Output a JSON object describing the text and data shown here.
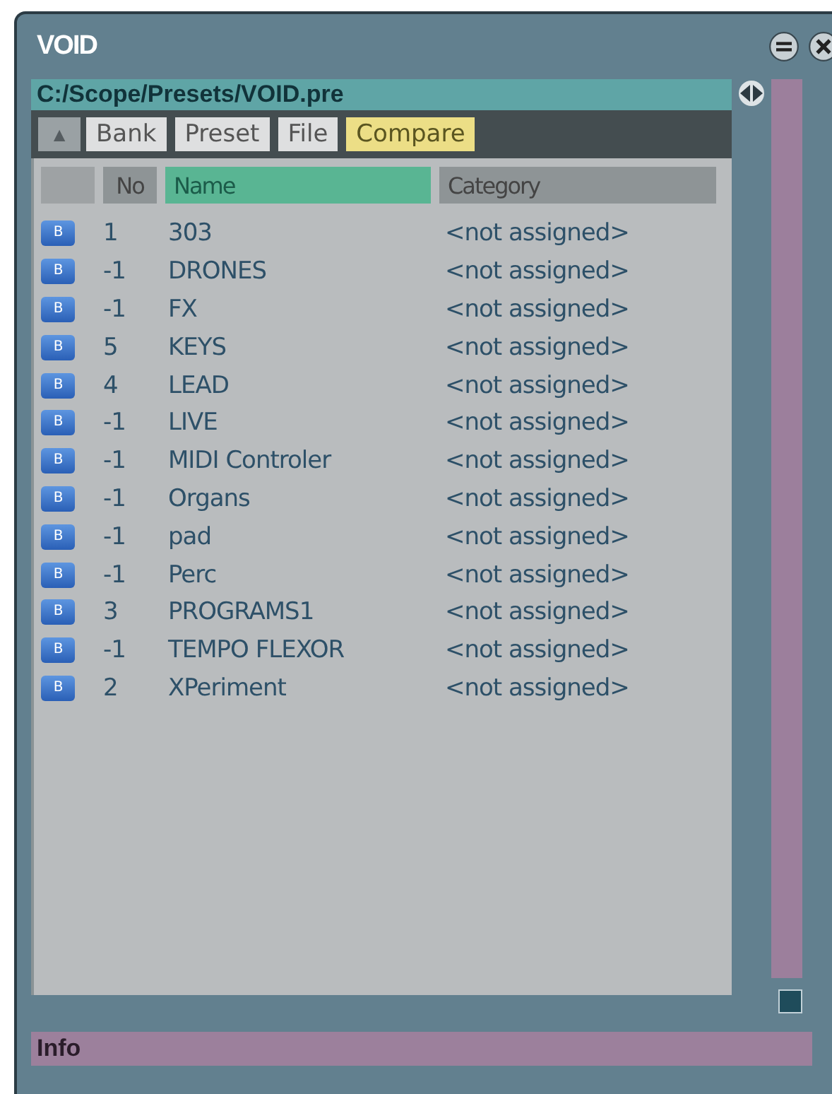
{
  "window": {
    "title": "VOID"
  },
  "path": "C:/Scope/Presets/VOID.pre",
  "toolbar": {
    "up_button": "▲",
    "tabs": [
      {
        "label": "Bank",
        "selected": false
      },
      {
        "label": "Preset",
        "selected": false
      },
      {
        "label": "File",
        "selected": false
      },
      {
        "label": "Compare",
        "selected": true
      }
    ]
  },
  "table": {
    "columns": [
      {
        "label": "No",
        "selected": false
      },
      {
        "label": "Name",
        "selected": true
      },
      {
        "label": "Category",
        "selected": false
      }
    ],
    "rows": [
      {
        "icon_letter": "B",
        "no": "1",
        "name": "303",
        "category": "<not assigned>"
      },
      {
        "icon_letter": "B",
        "no": "-1",
        "name": "DRONES",
        "category": "<not assigned>"
      },
      {
        "icon_letter": "B",
        "no": "-1",
        "name": "FX",
        "category": "<not assigned>"
      },
      {
        "icon_letter": "B",
        "no": "5",
        "name": "KEYS",
        "category": "<not assigned>"
      },
      {
        "icon_letter": "B",
        "no": "4",
        "name": "LEAD",
        "category": "<not assigned>"
      },
      {
        "icon_letter": "B",
        "no": "-1",
        "name": "LIVE",
        "category": "<not assigned>"
      },
      {
        "icon_letter": "B",
        "no": "-1",
        "name": "MIDI Controler",
        "category": "<not assigned>"
      },
      {
        "icon_letter": "B",
        "no": "-1",
        "name": "Organs",
        "category": "<not assigned>"
      },
      {
        "icon_letter": "B",
        "no": "-1",
        "name": "pad",
        "category": "<not assigned>"
      },
      {
        "icon_letter": "B",
        "no": "-1",
        "name": "Perc",
        "category": "<not assigned>"
      },
      {
        "icon_letter": "B",
        "no": "3",
        "name": "PROGRAMS1",
        "category": "<not assigned>"
      },
      {
        "icon_letter": "B",
        "no": "-1",
        "name": "TEMPO FLEXOR",
        "category": "<not assigned>"
      },
      {
        "icon_letter": "B",
        "no": "2",
        "name": "XPeriment",
        "category": "<not assigned>"
      }
    ]
  },
  "status_bar": {
    "label": "Info"
  }
}
